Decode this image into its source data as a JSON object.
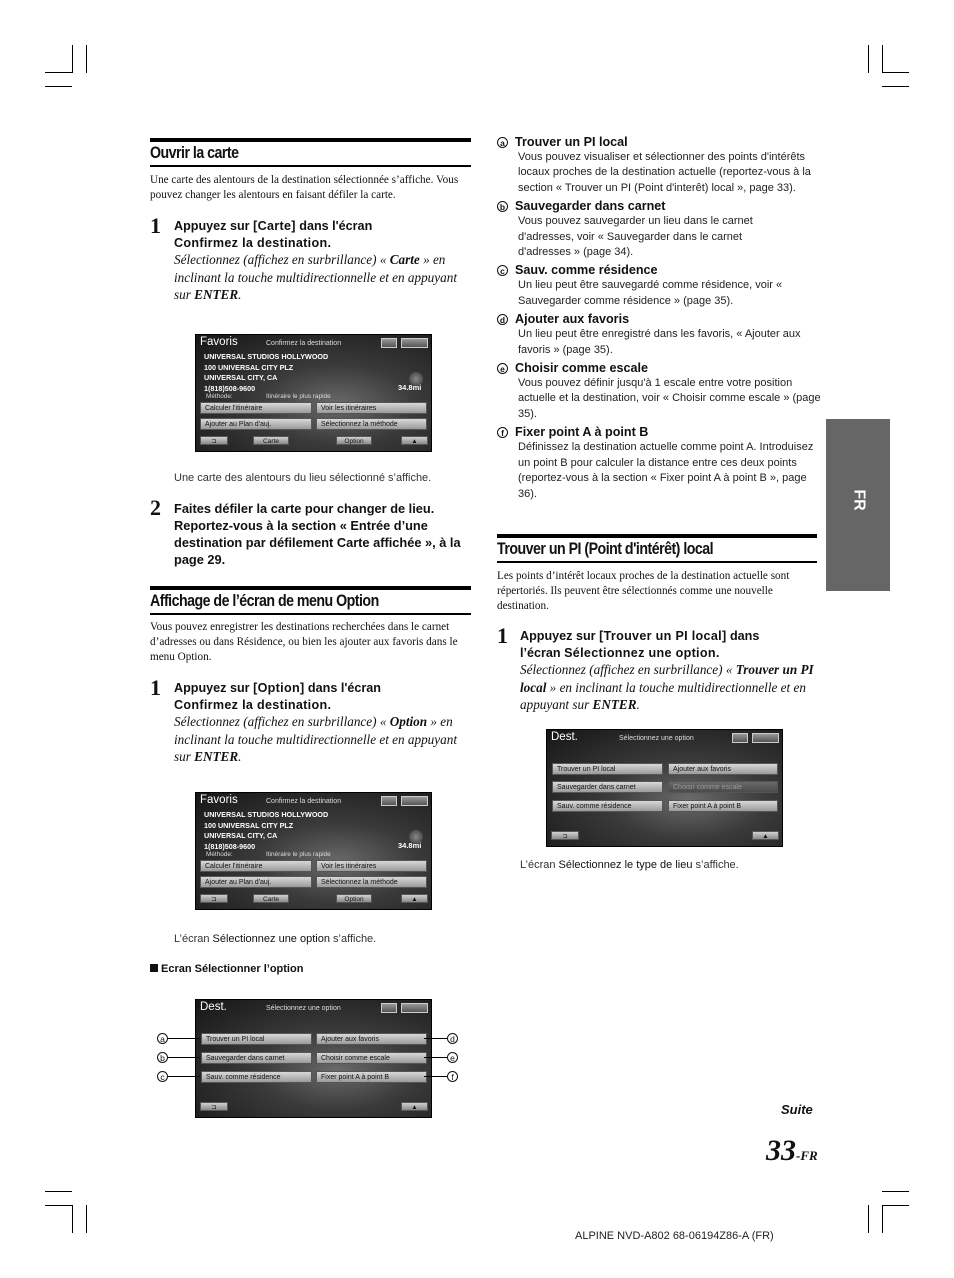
{
  "left": {
    "section1": {
      "heading": "Ouvrir la carte",
      "intro": "Une carte des alentours de la destination sélectionnée s’affiche. Vous pouvez changer les alentours en faisant défiler la carte.",
      "step1": {
        "num": "1",
        "line1_a": "Appuyez sur ",
        "line1_key": "[Carte]",
        "line1_b": " dans l'écran",
        "line2": "Confirmez la destination.",
        "italic_a": "Sélectionnez (affichez en surbrillance) « ",
        "italic_key": "Carte",
        "italic_b": " » en inclinant la touche multidirectionnelle et en appuyant sur ",
        "italic_enter": "ENTER",
        "italic_end": "."
      },
      "caption": "Une carte des alentours du lieu sélectionné s’affiche.",
      "step2": {
        "num": "2",
        "text": "Faites défiler la carte pour changer de lieu. Reportez-vous à la section « Entrée d’une destination par défilement Carte affichée », à la page 29."
      }
    },
    "section2": {
      "heading": "Affichage de l’écran de menu Option",
      "intro": "Vous pouvez enregistrer les destinations recherchées dans le carnet d’adresses ou dans Résidence, ou bien les ajouter aux favoris dans le menu Option.",
      "step1": {
        "num": "1",
        "line1_a": "Appuyez sur ",
        "line1_key": "[Option]",
        "line1_b": " dans l'écran",
        "line2": "Confirmez la destination.",
        "italic_a": "Sélectionnez (affichez en surbrillance) « ",
        "italic_key": "Option",
        "italic_b": " » en inclinant la touche multidirectionnelle et en appuyant sur ",
        "italic_enter": "ENTER",
        "italic_end": "."
      },
      "caption_a": "L’écran ",
      "caption_em": "Sélectionnez une option",
      "caption_b": " s’affiche.",
      "subheading": "Ecran Sélectionner l’option"
    }
  },
  "screen_confirm": {
    "title": "Favoris",
    "subtitle": "Confirmez la destination",
    "info": [
      "UNIVERSAL STUDIOS HOLLYWOOD",
      "100 UNIVERSAL CITY PLZ",
      "UNIVERSAL CITY, CA",
      "1(818)508-9600"
    ],
    "distance": "34.8mi",
    "method_label": "Méthode:",
    "method_value": "Itinéraire le plus rapide",
    "buttons": [
      "Calculer l'itinéraire",
      "Voir les itinéraires",
      "Ajouter au Plan d'auj.",
      "Sélectionnez la méthode"
    ],
    "bottom": {
      "back": "⊐",
      "carte": "Carte",
      "option": "Option",
      "up": "▲"
    }
  },
  "screen_option": {
    "title": "Dest.",
    "subtitle": "Sélectionnez une option",
    "buttons": [
      "Trouver un PI local",
      "Ajouter aux favoris",
      "Sauvegarder dans carnet",
      "Choisir comme escale",
      "Sauv. comme résidence",
      "Fixer point A à point B"
    ],
    "callouts_left": [
      "a",
      "b",
      "c"
    ],
    "callouts_right": [
      "d",
      "e",
      "f"
    ],
    "bottom": {
      "back": "⊐",
      "up": "▲"
    }
  },
  "right": {
    "items": [
      {
        "letter": "a",
        "title": "Trouver un PI local",
        "body": "Vous pouvez visualiser et sélectionner des points d'intérêts locaux proches de la destination actuelle (reportez-vous à la section « Trouver un PI (Point d'interêt) local », page 33)."
      },
      {
        "letter": "b",
        "title": "Sauvegarder dans carnet",
        "body": "Vous pouvez sauvegarder un lieu dans le carnet d'adresses, voir « Sauvegarder dans le carnet d'adresses » (page 34)."
      },
      {
        "letter": "c",
        "title": "Sauv. comme résidence",
        "body": "Un lieu peut être sauvegardé comme résidence, voir « Sauvegarder comme résidence » (page 35)."
      },
      {
        "letter": "d",
        "title": "Ajouter aux favoris",
        "body": "Un lieu peut être enregistré dans les favoris, « Ajouter aux favoris » (page 35)."
      },
      {
        "letter": "e",
        "title": "Choisir comme escale",
        "body": "Vous pouvez définir jusqu'à 1 escale entre votre position actuelle et la destination, voir « Choisir comme escale » (page 35)."
      },
      {
        "letter": "f",
        "title": "Fixer point A à point B",
        "body": "Définissez la destination actuelle comme point A. Introduisez un point B pour calculer la distance entre ces deux points (reportez-vous à la section « Fixer point A à point B », page 36)."
      }
    ],
    "section3": {
      "heading": "Trouver un PI (Point d'intérêt) local",
      "intro": "Les points d’intérêt locaux proches de la destination actuelle sont répertoriés. Ils peuvent être sélectionnés comme une nouvelle destination.",
      "step1": {
        "num": "1",
        "line1_a": "Appuyez sur ",
        "line1_key": "[Trouver un PI local]",
        "line1_b": " dans",
        "line2_a": "l’écran ",
        "line2_key": "Sélectionnez une option.",
        "italic_a": "Sélectionnez (affichez en surbrillance) « ",
        "italic_key": "Trouver un PI local",
        "italic_b": " » en inclinant la touche multidirectionnelle et en appuyant sur ",
        "italic_enter": "ENTER",
        "italic_end": "."
      },
      "caption_a": "L’écran ",
      "caption_em": "Sélectionnez le type de lieu",
      "caption_b": " s’affiche."
    }
  },
  "side_tab": "FR",
  "footer": {
    "suite": "Suite",
    "page_num": "33",
    "page_suffix": "-FR",
    "model": "ALPINE NVD-A802 68-06194Z86-A (FR)"
  }
}
